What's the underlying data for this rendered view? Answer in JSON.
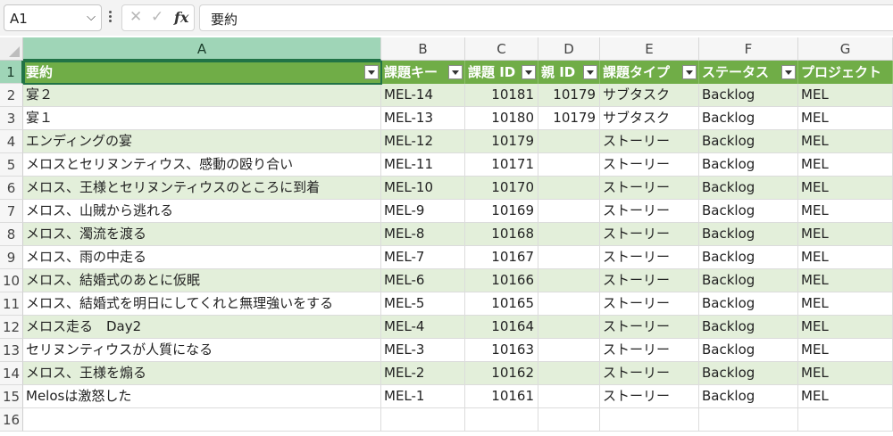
{
  "formula_bar": {
    "name_box": "A1",
    "name_box_arrow": "⌵",
    "cancel_glyph": "✕",
    "enter_glyph": "✓",
    "fx_label": "fx",
    "formula_value": "要約"
  },
  "columns": [
    {
      "letter": "A",
      "width": 401
    },
    {
      "letter": "B",
      "width": 94
    },
    {
      "letter": "C",
      "width": 82
    },
    {
      "letter": "D",
      "width": 69
    },
    {
      "letter": "E",
      "width": 111
    },
    {
      "letter": "F",
      "width": 111
    },
    {
      "letter": "G",
      "width": 106
    }
  ],
  "header_row": {
    "row_number": "1",
    "cells": [
      "要約",
      "課題キー",
      "課題 ID",
      "親 ID",
      "課題タイプ",
      "ステータス",
      "プロジェクト"
    ]
  },
  "rows": [
    {
      "row_number": "2",
      "cells": [
        "宴２",
        "MEL-14",
        "10181",
        "10179",
        "サブタスク",
        "Backlog",
        "MEL"
      ]
    },
    {
      "row_number": "3",
      "cells": [
        "宴１",
        "MEL-13",
        "10180",
        "10179",
        "サブタスク",
        "Backlog",
        "MEL"
      ]
    },
    {
      "row_number": "4",
      "cells": [
        "エンディングの宴",
        "MEL-12",
        "10179",
        "",
        "ストーリー",
        "Backlog",
        "MEL"
      ]
    },
    {
      "row_number": "5",
      "cells": [
        "メロスとセリヌンティウス、感動の殴り合い",
        "MEL-11",
        "10171",
        "",
        "ストーリー",
        "Backlog",
        "MEL"
      ]
    },
    {
      "row_number": "6",
      "cells": [
        "メロス、王様とセリヌンティウスのところに到着",
        "MEL-10",
        "10170",
        "",
        "ストーリー",
        "Backlog",
        "MEL"
      ]
    },
    {
      "row_number": "7",
      "cells": [
        "メロス、山賊から逃れる",
        "MEL-9",
        "10169",
        "",
        "ストーリー",
        "Backlog",
        "MEL"
      ]
    },
    {
      "row_number": "8",
      "cells": [
        "メロス、濁流を渡る",
        "MEL-8",
        "10168",
        "",
        "ストーリー",
        "Backlog",
        "MEL"
      ]
    },
    {
      "row_number": "9",
      "cells": [
        "メロス、雨の中走る",
        "MEL-7",
        "10167",
        "",
        "ストーリー",
        "Backlog",
        "MEL"
      ]
    },
    {
      "row_number": "10",
      "cells": [
        "メロス、結婚式のあとに仮眠",
        "MEL-6",
        "10166",
        "",
        "ストーリー",
        "Backlog",
        "MEL"
      ]
    },
    {
      "row_number": "11",
      "cells": [
        "メロス、結婚式を明日にしてくれと無理強いをする",
        "MEL-5",
        "10165",
        "",
        "ストーリー",
        "Backlog",
        "MEL"
      ]
    },
    {
      "row_number": "12",
      "cells": [
        "メロス走る　Day2",
        "MEL-4",
        "10164",
        "",
        "ストーリー",
        "Backlog",
        "MEL"
      ]
    },
    {
      "row_number": "13",
      "cells": [
        "セリヌンティウスが人質になる",
        "MEL-3",
        "10163",
        "",
        "ストーリー",
        "Backlog",
        "MEL"
      ]
    },
    {
      "row_number": "14",
      "cells": [
        "メロス、王様を煽る",
        "MEL-2",
        "10162",
        "",
        "ストーリー",
        "Backlog",
        "MEL"
      ]
    },
    {
      "row_number": "15",
      "cells": [
        "Melosは激怒した",
        "MEL-1",
        "10161",
        "",
        "ストーリー",
        "Backlog",
        "MEL"
      ]
    }
  ],
  "empty_rows": [
    "16"
  ],
  "numeric_columns": [
    2,
    3
  ],
  "colors": {
    "table_header": "#70ad47",
    "band_row": "#e3efda",
    "selection": "#217346",
    "selected_header": "#9fd5b7"
  }
}
